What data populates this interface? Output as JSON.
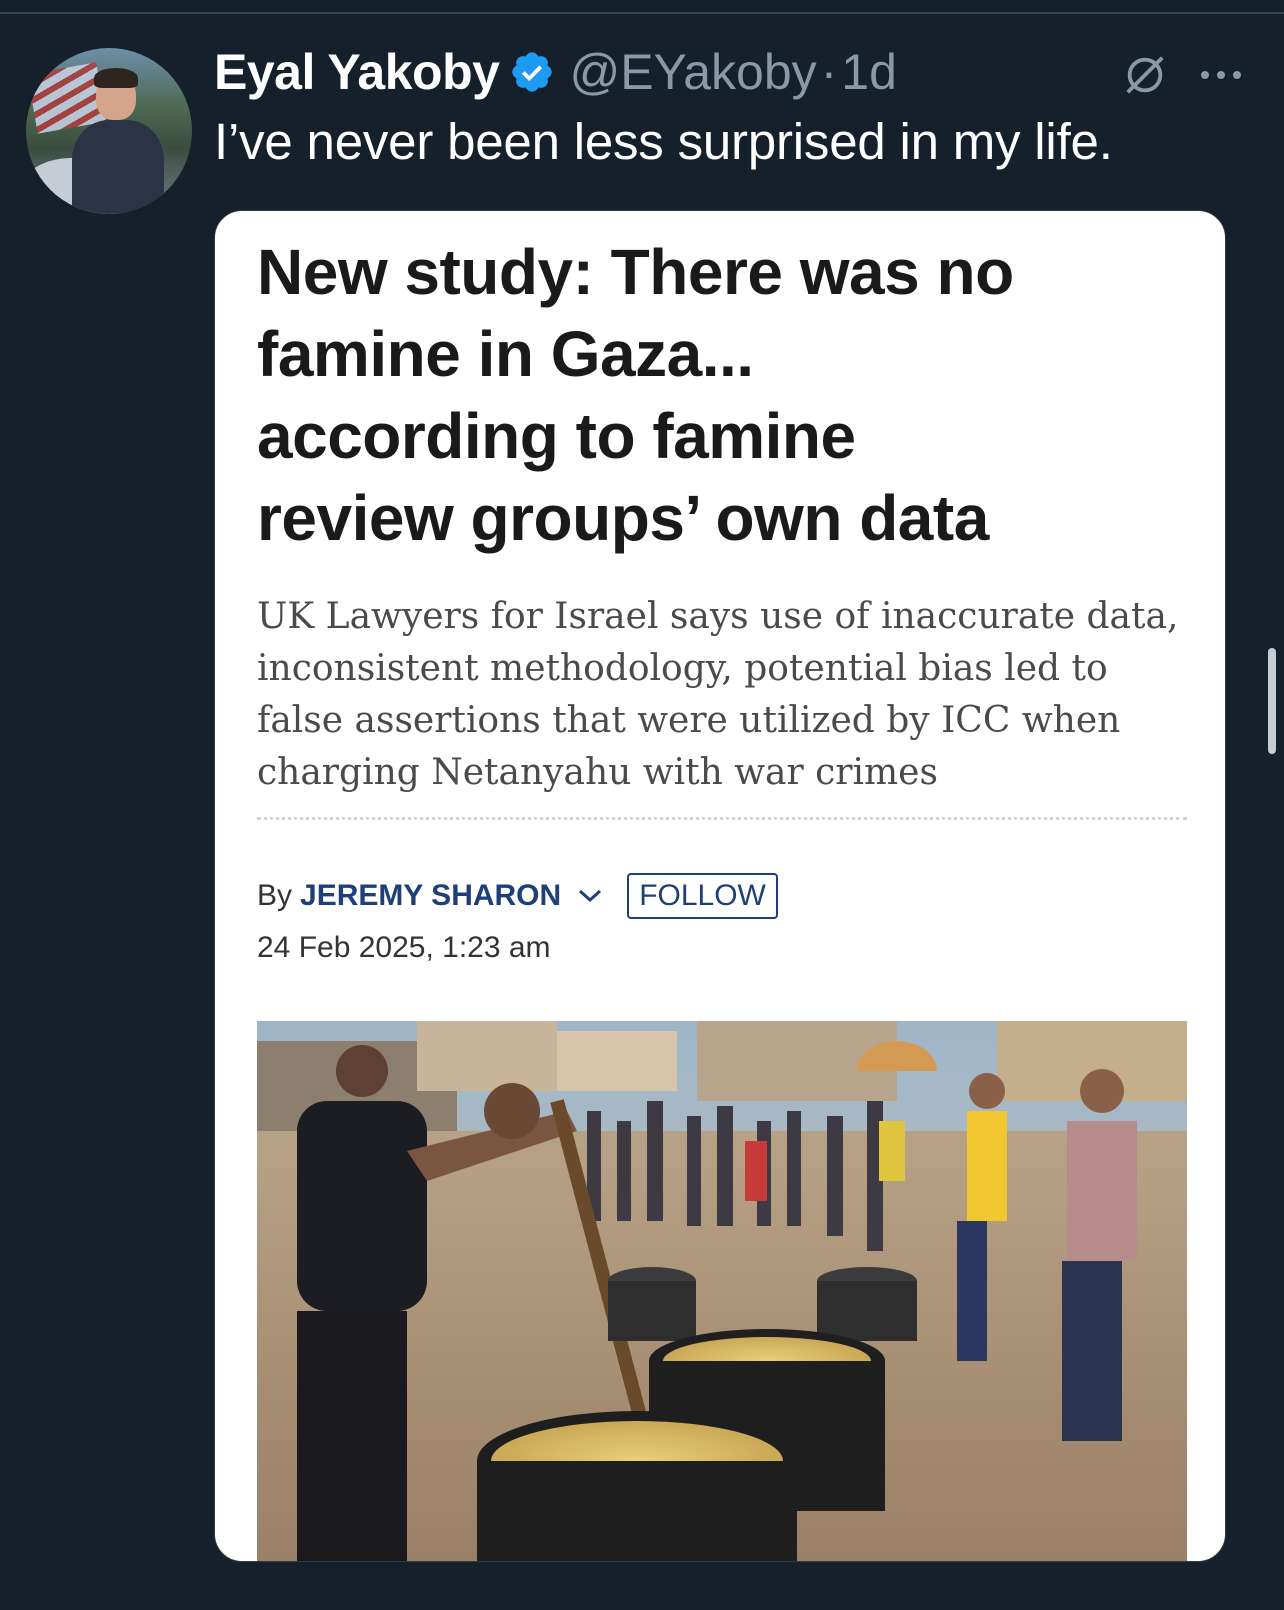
{
  "tweet": {
    "author_name": "Eyal Yakoby",
    "handle": "@EYakoby",
    "separator": "·",
    "time": "1d",
    "text": "I’ve never been less surprised in my life.",
    "avatar_icon": "profile-photo",
    "verified_icon": "verified-badge-icon",
    "verified_color": "#1d9bf0",
    "actions": {
      "grok_icon": "grok-icon",
      "more_icon": "more-dots-icon"
    }
  },
  "article": {
    "headline": [
      "New study: There was no",
      "famine in Gaza...",
      "according to famine",
      "review groups’ own data"
    ],
    "subhead": [
      "UK Lawyers for Israel says use of inaccurate data,",
      "inconsistent methodology, potential bias led to",
      "false assertions that were utilized by ICC when",
      "charging Netanyahu with war crimes"
    ],
    "by_label": "By",
    "author": "JEREMY SHARON",
    "follow_label": "FOLLOW",
    "date": "24 Feb 2025, 1:23 am",
    "accent_color": "#1f3f7a",
    "photo_description_icon": "news-photo"
  },
  "theme": {
    "background": "#15202b",
    "text_primary": "#ffffff",
    "text_secondary": "#8b98a5"
  }
}
